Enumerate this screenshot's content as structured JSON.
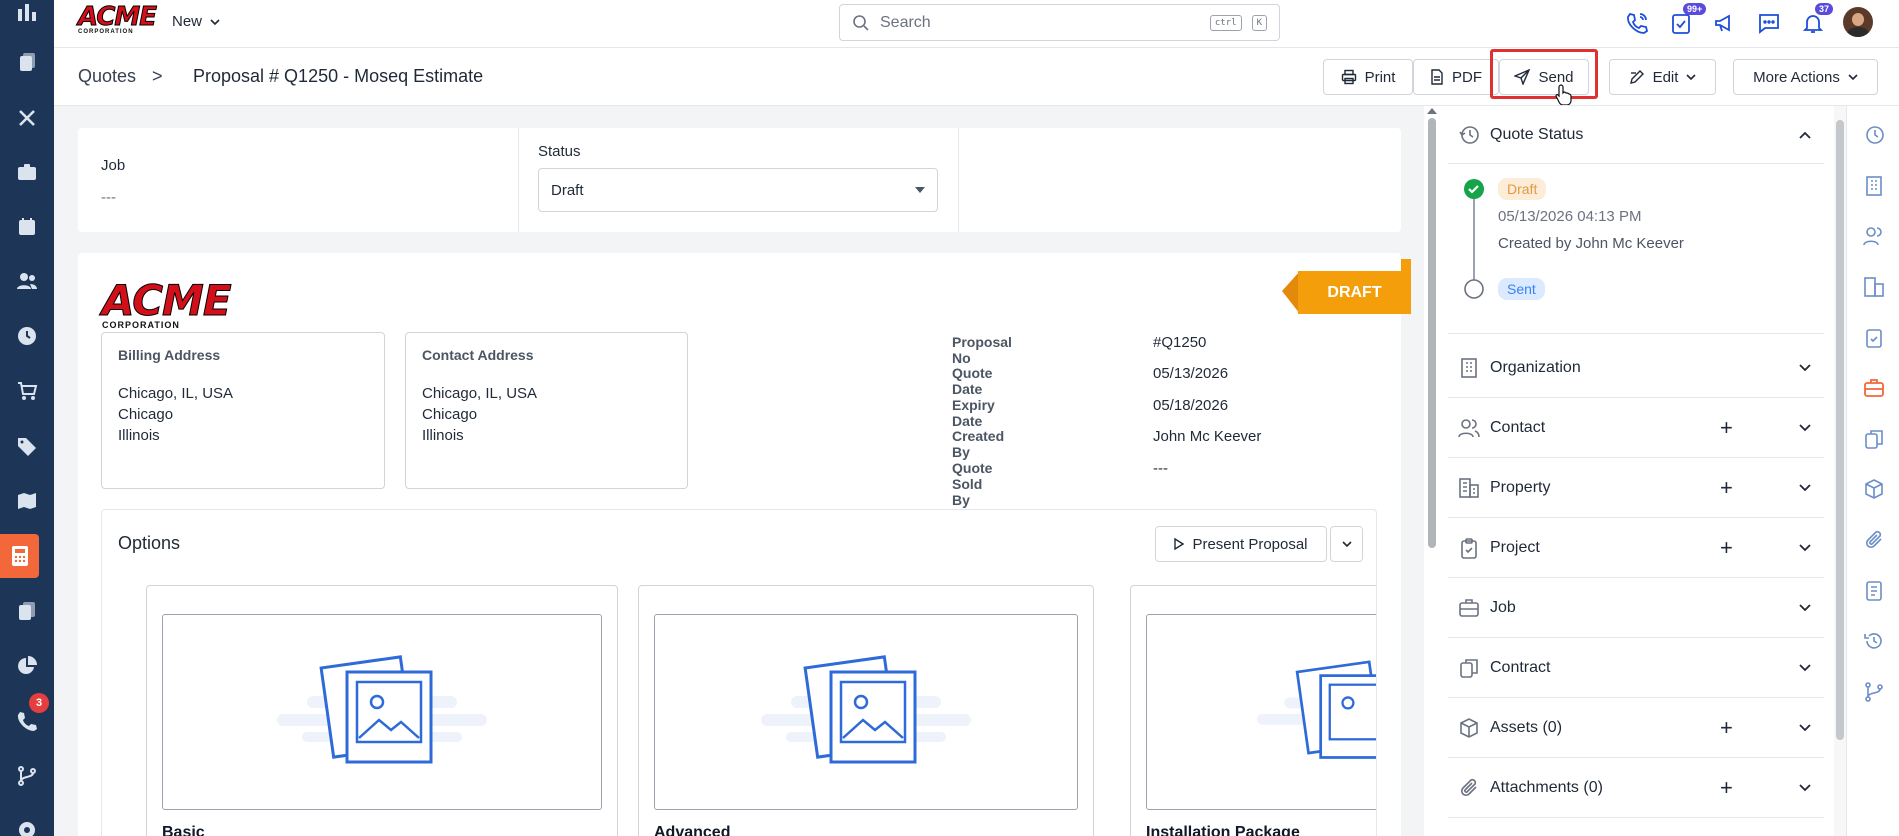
{
  "topbar": {
    "logo_main": "ACME",
    "logo_sub": "CORPORATION",
    "new_label": "New",
    "search_placeholder": "Search",
    "kbd_ctrl": "ctrl",
    "kbd_k": "K",
    "tasks_badge": "99+",
    "notifications_badge": "37"
  },
  "breadcrumb": {
    "root": "Quotes",
    "separator": ">",
    "title": "Proposal # Q1250 - Moseq Estimate"
  },
  "toolbar": {
    "print": "Print",
    "pdf": "PDF",
    "send": "Send",
    "edit": "Edit",
    "more_actions": "More Actions"
  },
  "leftnav": {
    "badge": "3"
  },
  "status_card": {
    "job_label": "Job",
    "job_value": "---",
    "status_label": "Status",
    "status_value": "Draft"
  },
  "proposal": {
    "ribbon": "DRAFT",
    "logo_main": "ACME",
    "logo_sub": "CORPORATION",
    "billing": {
      "title": "Billing Address",
      "lines": [
        "Chicago, IL, USA",
        "Chicago",
        "Illinois"
      ]
    },
    "contact": {
      "title": "Contact Address",
      "lines": [
        "Chicago, IL, USA",
        "Chicago",
        "Illinois"
      ]
    },
    "meta": [
      {
        "label": "Proposal No",
        "value": "#Q1250"
      },
      {
        "label": "Quote Date",
        "value": "05/13/2026"
      },
      {
        "label": "Expiry Date",
        "value": "05/18/2026"
      },
      {
        "label": "Created By",
        "value": "John Mc Keever"
      },
      {
        "label": "Quote Sold By",
        "value": "---"
      }
    ],
    "options_title": "Options",
    "present_button": "Present Proposal",
    "options": [
      "Basic",
      "Advanced",
      "Installation Package"
    ]
  },
  "right_panel": {
    "quote_status_title": "Quote Status",
    "timeline": [
      {
        "status": "Draft",
        "date": "05/13/2026 04:13 PM",
        "note": "Created by John Mc Keever"
      },
      {
        "status": "Sent"
      }
    ],
    "sections": [
      {
        "name": "Organization",
        "icon": "building-icon",
        "addable": false
      },
      {
        "name": "Contact",
        "icon": "people-icon",
        "addable": true
      },
      {
        "name": "Property",
        "icon": "property-icon",
        "addable": true
      },
      {
        "name": "Project",
        "icon": "clipboard-icon",
        "addable": true
      },
      {
        "name": "Job",
        "icon": "briefcase-icon",
        "addable": false
      },
      {
        "name": "Contract",
        "icon": "document-copy-icon",
        "addable": false
      },
      {
        "name": "Assets (0)",
        "icon": "cube-icon",
        "addable": true
      },
      {
        "name": "Attachments (0)",
        "icon": "paperclip-icon",
        "addable": true
      }
    ]
  },
  "colors": {
    "nav_bg": "#1d3557",
    "accent": "#f2683a",
    "ribbon": "#f59e0b",
    "highlight": "#e03131",
    "icon_blue": "#1d4ed8"
  }
}
